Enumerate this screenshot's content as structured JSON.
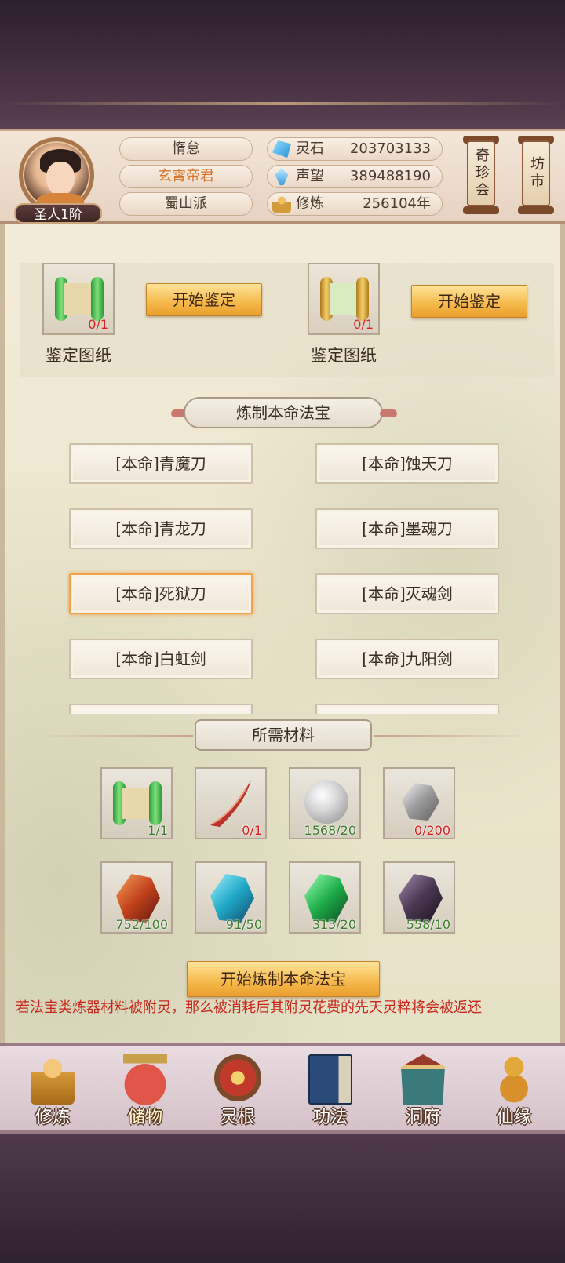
{
  "player": {
    "rank": "圣人1阶",
    "status": "惰怠",
    "name": "玄霄帝君",
    "sect": "蜀山派"
  },
  "resources": [
    {
      "label": "灵石",
      "value": "203703133",
      "icon": "spirit-stone-icon"
    },
    {
      "label": "声望",
      "value": "389488190",
      "icon": "reputation-icon"
    },
    {
      "label": "修炼",
      "value": "256104年",
      "icon": "cultivation-icon"
    }
  ],
  "header_buttons": {
    "treasure": "奇珍会",
    "market": "坊市"
  },
  "appraise": [
    {
      "caption": "鉴定图纸",
      "count": "0/1",
      "button": "开始鉴定",
      "color": "green"
    },
    {
      "caption": "鉴定图纸",
      "count": "0/1",
      "button": "开始鉴定",
      "color": "gold"
    }
  ],
  "craft_title": "炼制本命法宝",
  "weapons": [
    {
      "label": "[本命]青魔刀",
      "selected": false
    },
    {
      "label": "[本命]蚀天刀",
      "selected": false
    },
    {
      "label": "[本命]青龙刀",
      "selected": false
    },
    {
      "label": "[本命]墨魂刀",
      "selected": false
    },
    {
      "label": "[本命]死狱刀",
      "selected": true
    },
    {
      "label": "[本命]灭魂剑",
      "selected": false
    },
    {
      "label": "[本命]白虹剑",
      "selected": false
    },
    {
      "label": "[本命]九阳剑",
      "selected": false
    },
    {
      "label": "",
      "selected": false
    },
    {
      "label": "",
      "selected": false
    }
  ],
  "materials_title": "所需材料",
  "materials": [
    {
      "name": "blueprint-scroll",
      "count": "1/1",
      "enough": true
    },
    {
      "name": "red-blade",
      "count": "0/1",
      "enough": false
    },
    {
      "name": "silver-orb",
      "count": "1568/20",
      "enough": true
    },
    {
      "name": "silver-ore",
      "count": "0/200",
      "enough": false
    },
    {
      "name": "red-crystal",
      "count": "752/100",
      "enough": true
    },
    {
      "name": "blue-crystal",
      "count": "91/50",
      "enough": true
    },
    {
      "name": "green-crystal",
      "count": "315/20",
      "enough": true
    },
    {
      "name": "dark-crystal",
      "count": "558/10",
      "enough": true
    }
  ],
  "craft_button": "开始炼制本命法宝",
  "notice": "若法宝类炼器材料被附灵，那么被消耗后其附灵花费的先天灵粹将会被返还",
  "nav": [
    {
      "label": "修炼",
      "icon": "monk-icon"
    },
    {
      "label": "储物",
      "icon": "bag-icon"
    },
    {
      "label": "灵根",
      "icon": "spirit-root-icon"
    },
    {
      "label": "功法",
      "icon": "book-icon"
    },
    {
      "label": "洞府",
      "icon": "cave-house-icon"
    },
    {
      "label": "仙缘",
      "icon": "gourd-icon"
    }
  ],
  "colors": {
    "accent": "#f5b84a",
    "warning_text": "#c7271c",
    "enough": "#3f7a2f",
    "not_enough": "#d8201e",
    "selected_border": "#f0a14a"
  }
}
